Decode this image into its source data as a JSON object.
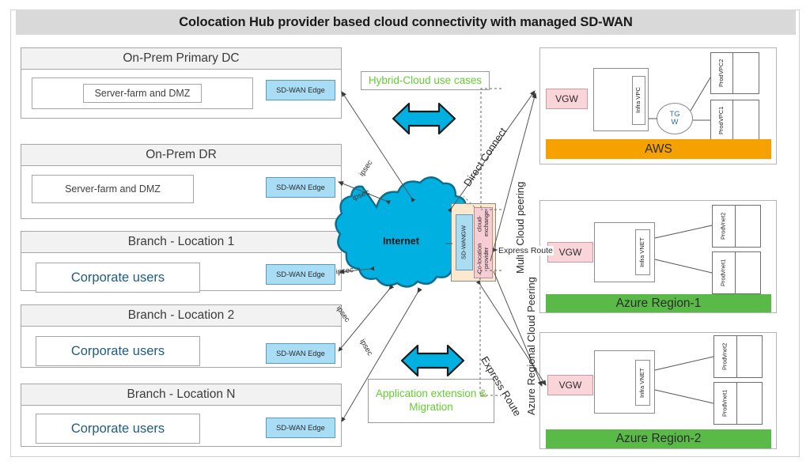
{
  "header": {
    "title": "Colocation Hub provider based cloud connectivity with managed SD-WAN"
  },
  "sites": [
    {
      "name": "On-Prem Primary DC",
      "inner_label": "Server-farm and DMZ",
      "edge_label": "SD-WAN Edge",
      "kind": "dc"
    },
    {
      "name": "On-Prem DR",
      "inner_label": "Server-farm and DMZ",
      "edge_label": "SD-WAN Edge",
      "kind": "dc"
    },
    {
      "name": "Branch - Location 1",
      "inner_label": "Corporate users",
      "edge_label": "SD-WAN Edge",
      "kind": "branch"
    },
    {
      "name": "Branch - Location 2",
      "inner_label": "Corporate users",
      "edge_label": "SD-WAN Edge",
      "kind": "branch"
    },
    {
      "name": "Branch - Location N",
      "inner_label": "Corporate users",
      "edge_label": "SD-WAN Edge",
      "kind": "branch"
    }
  ],
  "internet": {
    "label": "Internet",
    "color": "#00b0e0"
  },
  "colocation_hub": {
    "sdwan_gw": {
      "line1": "SD-WAN",
      "line2": "GW",
      "color": "#aadcf2"
    },
    "cloud_exchange": {
      "line1": "Co-location provider",
      "line2": "cloud-exchange",
      "color": "#f7cdd4"
    },
    "outer_color": "#fbe8cf"
  },
  "callouts": [
    {
      "id": "hybrid",
      "text": "Hybrid-Cloud use cases",
      "color": "#66cc33"
    },
    {
      "id": "appext",
      "line1": "Application extension &",
      "line2": "Migration",
      "color": "#66cc33"
    }
  ],
  "connection_labels": {
    "ipsec": "ipsec",
    "direct_connect": "Direct Connect",
    "multi_cloud_peering": "Multi- Cloud peering",
    "express_route": "Express Route",
    "express_route_diag": "Express Route",
    "azure_regional_peering": "Azure Regional Cloud Peering"
  },
  "regions": [
    {
      "id": "aws",
      "footer": "AWS",
      "footer_color": "#f5a200",
      "vgw": "VGW",
      "infra": "Infra VPC",
      "has_tgw": true,
      "tgw": {
        "line1": "TG",
        "line2": "W"
      },
      "prod": [
        {
          "line1": "Prod",
          "line2": "VPC2"
        },
        {
          "line1": "Prod",
          "line2": "VPC1"
        }
      ]
    },
    {
      "id": "azure1",
      "footer": "Azure Region-1",
      "footer_color": "#5aba47",
      "vgw": "VGW",
      "infra": "Infra VNET",
      "has_tgw": false,
      "prod": [
        {
          "line1": "Prod",
          "line2": "Vnet2"
        },
        {
          "line1": "Prod",
          "line2": "Vnet1"
        }
      ]
    },
    {
      "id": "azure2",
      "footer": "Azure  Region-2",
      "footer_color": "#5aba47",
      "vgw": "VGW",
      "infra": "Infra VNET",
      "has_tgw": false,
      "prod": [
        {
          "line1": "Prod",
          "line2": "Vnet2"
        },
        {
          "line1": "Prod",
          "line2": "Vnet1"
        }
      ]
    }
  ]
}
